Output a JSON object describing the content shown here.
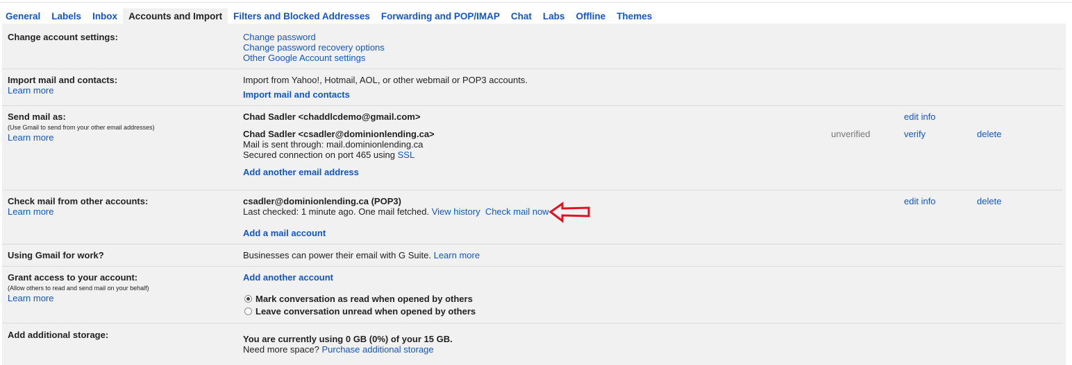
{
  "tabs": [
    {
      "label": "General"
    },
    {
      "label": "Labels"
    },
    {
      "label": "Inbox"
    },
    {
      "label": "Accounts and Import"
    },
    {
      "label": "Filters and Blocked Addresses"
    },
    {
      "label": "Forwarding and POP/IMAP"
    },
    {
      "label": "Chat"
    },
    {
      "label": "Labs"
    },
    {
      "label": "Offline"
    },
    {
      "label": "Themes"
    }
  ],
  "change_account": {
    "label": "Change account settings:",
    "links": [
      "Change password",
      "Change password recovery options",
      "Other Google Account settings"
    ]
  },
  "import": {
    "label": "Import mail and contacts:",
    "learn_more": "Learn more",
    "description": "Import from Yahoo!, Hotmail, AOL, or other webmail or POP3 accounts.",
    "action": "Import mail and contacts"
  },
  "send_as": {
    "label": "Send mail as:",
    "sublabel": "(Use Gmail to send from your other email addresses)",
    "learn_more": "Learn more",
    "accounts": [
      {
        "name": "Chad Sadler <chaddlcdemo@gmail.com>",
        "edit": "edit info"
      },
      {
        "name": "Chad Sadler <csadler@dominionlending.ca>",
        "line1": "Mail is sent through: mail.dominionlending.ca",
        "line2_prefix": "Secured connection on port 465 using ",
        "line2_link": "SSL",
        "status": "unverified",
        "verify": "verify",
        "delete": "delete"
      }
    ],
    "add": "Add another email address"
  },
  "check_mail": {
    "label": "Check mail from other accounts:",
    "learn_more": "Learn more",
    "account": "csadler@dominionlending.ca (POP3)",
    "status": "Last checked: 1 minute ago. One mail fetched.",
    "view_history": "View history",
    "check_now": "Check mail now",
    "edit": "edit info",
    "delete": "delete",
    "add": "Add a mail account"
  },
  "work": {
    "label": "Using Gmail for work?",
    "text": "Businesses can power their email with G Suite.",
    "learn_more": "Learn more"
  },
  "grant": {
    "label": "Grant access to your account:",
    "sublabel": "(Allow others to read and send mail on your behalf)",
    "learn_more": "Learn more",
    "add": "Add another account",
    "option1": "Mark conversation as read when opened by others",
    "option2": "Leave conversation unread when opened by others"
  },
  "storage": {
    "label": "Add additional storage:",
    "usage": "You are currently using 0 GB (0%) of your 15 GB.",
    "need_more": "Need more space?",
    "purchase": "Purchase additional storage"
  },
  "annotation": {
    "icon": "arrow-left-icon",
    "color": "#e0121f"
  }
}
